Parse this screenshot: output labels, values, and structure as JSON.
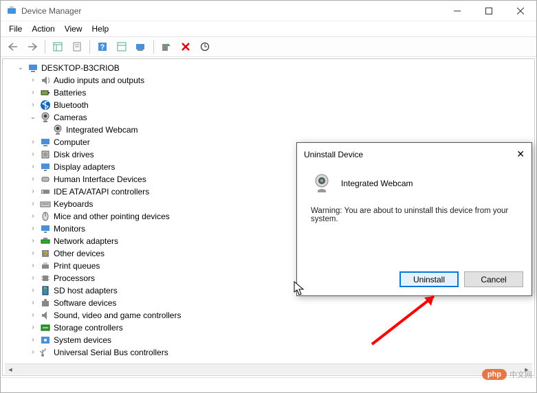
{
  "window": {
    "title": "Device Manager"
  },
  "menubar": [
    "File",
    "Action",
    "View",
    "Help"
  ],
  "tree": {
    "root": "DESKTOP-B3CRIOB",
    "items": [
      {
        "label": "Audio inputs and outputs",
        "icon": "audio"
      },
      {
        "label": "Batteries",
        "icon": "battery"
      },
      {
        "label": "Bluetooth",
        "icon": "bluetooth"
      },
      {
        "label": "Cameras",
        "icon": "camera",
        "expanded": true,
        "children": [
          {
            "label": "Integrated Webcam",
            "icon": "camera"
          }
        ]
      },
      {
        "label": "Computer",
        "icon": "computer"
      },
      {
        "label": "Disk drives",
        "icon": "disk"
      },
      {
        "label": "Display adapters",
        "icon": "display"
      },
      {
        "label": "Human Interface Devices",
        "icon": "hid"
      },
      {
        "label": "IDE ATA/ATAPI controllers",
        "icon": "ide"
      },
      {
        "label": "Keyboards",
        "icon": "keyboard"
      },
      {
        "label": "Mice and other pointing devices",
        "icon": "mouse"
      },
      {
        "label": "Monitors",
        "icon": "monitor"
      },
      {
        "label": "Network adapters",
        "icon": "network"
      },
      {
        "label": "Other devices",
        "icon": "other"
      },
      {
        "label": "Print queues",
        "icon": "printer"
      },
      {
        "label": "Processors",
        "icon": "cpu"
      },
      {
        "label": "SD host adapters",
        "icon": "sd"
      },
      {
        "label": "Software devices",
        "icon": "software"
      },
      {
        "label": "Sound, video and game controllers",
        "icon": "sound"
      },
      {
        "label": "Storage controllers",
        "icon": "storage"
      },
      {
        "label": "System devices",
        "icon": "system"
      },
      {
        "label": "Universal Serial Bus controllers",
        "icon": "usb"
      }
    ]
  },
  "dialog": {
    "title": "Uninstall Device",
    "device": "Integrated Webcam",
    "warning": "Warning: You are about to uninstall this device from your system.",
    "primary": "Uninstall",
    "cancel": "Cancel"
  },
  "watermark": {
    "logo": "php",
    "text": "中文网"
  }
}
